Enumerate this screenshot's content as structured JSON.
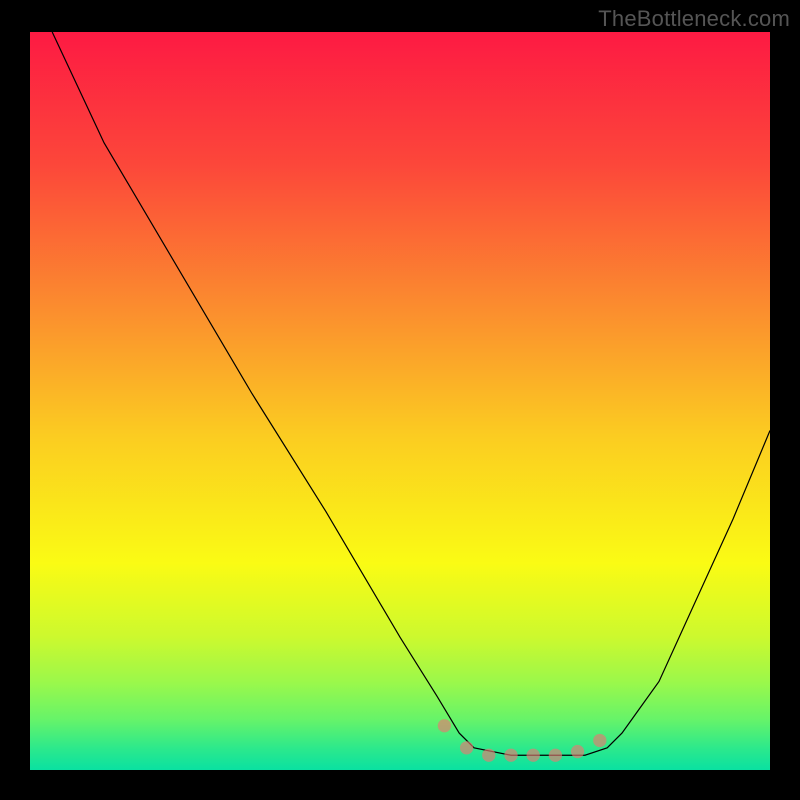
{
  "watermark": "TheBottleneck.com",
  "chart_data": {
    "type": "line",
    "title": "",
    "xlabel": "",
    "ylabel": "",
    "xlim": [
      0,
      100
    ],
    "ylim": [
      0,
      100
    ],
    "grid": false,
    "series": [
      {
        "name": "curve",
        "color": "#000000",
        "x": [
          3,
          10,
          20,
          30,
          40,
          50,
          55,
          58,
          60,
          65,
          70,
          75,
          78,
          80,
          85,
          90,
          95,
          100
        ],
        "values": [
          100,
          85,
          68,
          51,
          35,
          18,
          10,
          5,
          3,
          2,
          2,
          2,
          3,
          5,
          12,
          23,
          34,
          46
        ]
      }
    ],
    "highlight": {
      "color": "#e77a71",
      "x": [
        56,
        59,
        62,
        65,
        68,
        71,
        74,
        77
      ],
      "values": [
        6,
        3,
        2,
        2,
        2,
        2,
        2.5,
        4
      ]
    },
    "background_gradient": {
      "stops": [
        {
          "offset": 0.0,
          "color": "#fd1a43"
        },
        {
          "offset": 0.18,
          "color": "#fc473a"
        },
        {
          "offset": 0.38,
          "color": "#fb8f2e"
        },
        {
          "offset": 0.55,
          "color": "#fbcd21"
        },
        {
          "offset": 0.72,
          "color": "#fafb14"
        },
        {
          "offset": 0.82,
          "color": "#ccf92e"
        },
        {
          "offset": 0.88,
          "color": "#9cf84a"
        },
        {
          "offset": 0.93,
          "color": "#68f468"
        },
        {
          "offset": 0.97,
          "color": "#2de98b"
        },
        {
          "offset": 1.0,
          "color": "#0ae1a1"
        }
      ]
    }
  }
}
